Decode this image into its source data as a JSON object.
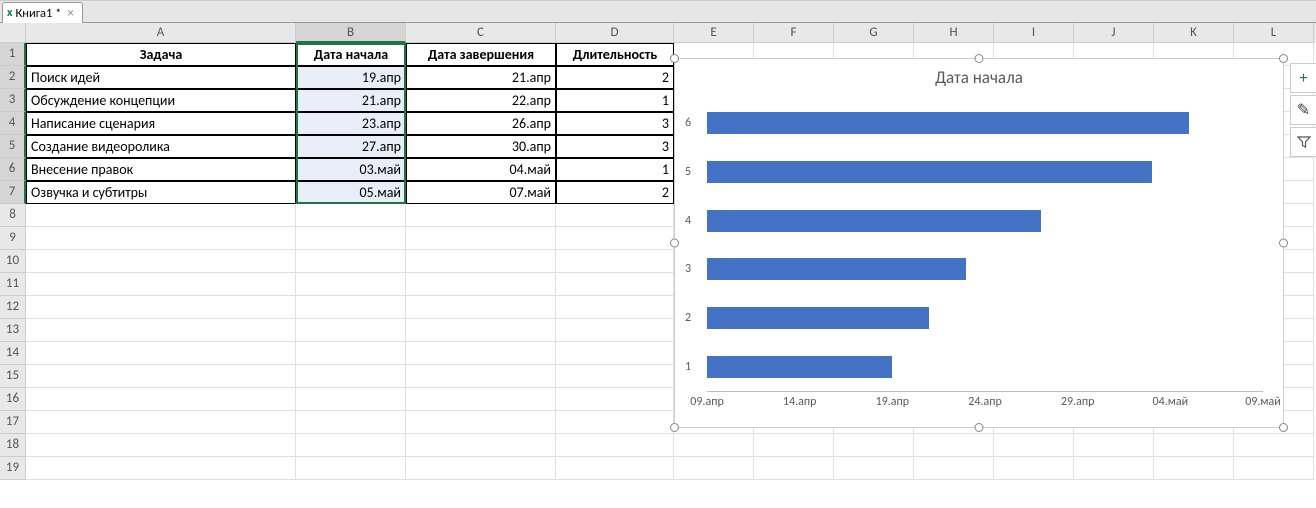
{
  "tab": {
    "icon_text": "x",
    "name": "Книга1 *",
    "close": "×"
  },
  "columns": [
    "A",
    "B",
    "C",
    "D",
    "E",
    "F",
    "G",
    "H",
    "I",
    "J",
    "K",
    "L"
  ],
  "headers": {
    "A": "Задача",
    "B": "Дата начала",
    "C": "Дата завершения",
    "D": "Длительность"
  },
  "tasks": [
    {
      "name": "Поиск идей",
      "start": "19.апр",
      "end": "21.апр",
      "dur": "2"
    },
    {
      "name": "Обсуждение концепции",
      "start": "21.апр",
      "end": "22.апр",
      "dur": "1"
    },
    {
      "name": "Написание сценария",
      "start": "23.апр",
      "end": "26.апр",
      "dur": "3"
    },
    {
      "name": "Создание видеоролика",
      "start": "27.апр",
      "end": "30.апр",
      "dur": "3"
    },
    {
      "name": "Внесение правок",
      "start": "03.май",
      "end": "04.май",
      "dur": "1"
    },
    {
      "name": "Озвучка и субтитры",
      "start": "05.май",
      "end": "07.май",
      "dur": "2"
    }
  ],
  "selection": {
    "range": "B1:B7",
    "active": "B1"
  },
  "side_buttons": {
    "add": "+",
    "brush": "✎",
    "filter": "⧩"
  },
  "chart_data": {
    "type": "bar",
    "orientation": "horizontal",
    "title": "Дата начала",
    "categories": [
      "1",
      "2",
      "3",
      "4",
      "5",
      "6"
    ],
    "values": [
      "19.апр",
      "21.апр",
      "23.апр",
      "27.апр",
      "03.май",
      "05.май"
    ],
    "x_ticks": [
      "09.апр",
      "14.апр",
      "19.апр",
      "24.апр",
      "29.апр",
      "04.май",
      "09.май"
    ],
    "x_range_days": [
      0,
      30
    ],
    "value_days": [
      10,
      12,
      14,
      18,
      24,
      26
    ],
    "bar_color": "#4472c4"
  }
}
